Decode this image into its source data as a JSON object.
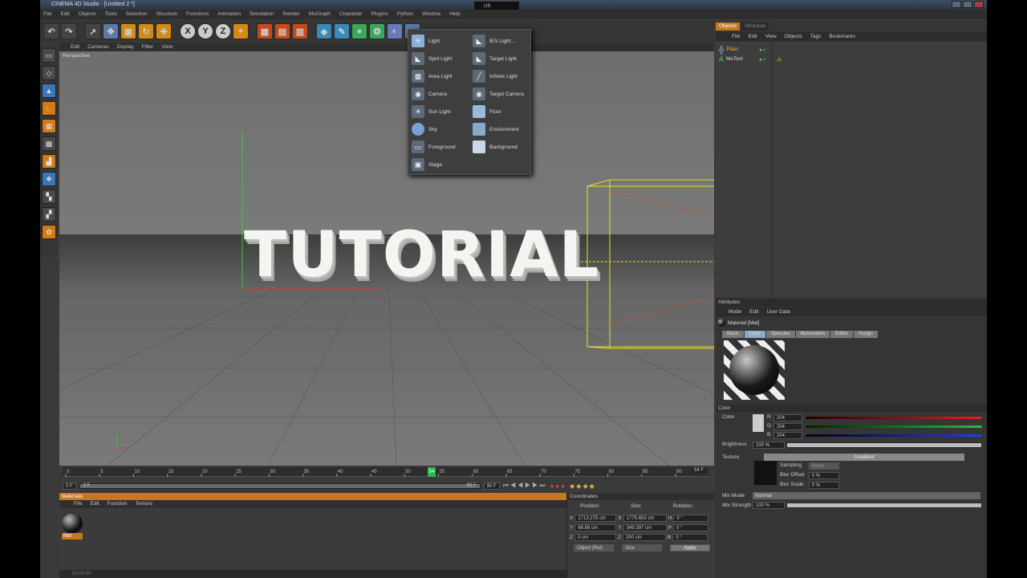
{
  "app": {
    "title": "CINEMA 4D Studio - [Untitled 2 *]",
    "lang": "US"
  },
  "menu": [
    "File",
    "Edit",
    "Objects",
    "Tools",
    "Selection",
    "Structure",
    "Functions",
    "Animation",
    "Simulation",
    "Render",
    "MoGraph",
    "Character",
    "Plugins",
    "Python",
    "Window",
    "Help"
  ],
  "toolbar": {
    "axis_labels": [
      "X",
      "Y",
      "Z"
    ]
  },
  "viewport": {
    "menu": [
      "Edit",
      "Cameras",
      "Display",
      "Filter",
      "View"
    ],
    "label": "Perspective",
    "text3d": "TUTORIAL"
  },
  "popup": {
    "left": [
      "Light",
      "Spot Light",
      "Area Light",
      "Camera",
      "Sun Light",
      "Sky",
      "Foreground",
      "Stage"
    ],
    "right": [
      "IES Light...",
      "Target Light",
      "Infinite Light",
      "Target Camera",
      "Floor",
      "Environment",
      "Background"
    ]
  },
  "timeline": {
    "ticks": [
      "0",
      "5",
      "10",
      "15",
      "20",
      "25",
      "30",
      "35",
      "40",
      "45",
      "50",
      "55",
      "60",
      "65",
      "70",
      "75",
      "80",
      "85",
      "90"
    ],
    "current_frame": 54,
    "current_label": "54",
    "end_label": "54 F",
    "start_field": "0 F",
    "min_field": "0 F",
    "max_field": "90 F",
    "end_field": "90 F"
  },
  "materials": {
    "header": "Materials",
    "menu": [
      "File",
      "Edit",
      "Function",
      "Texture"
    ],
    "item": "Mat"
  },
  "coordinates": {
    "header": "Coordinates",
    "cols": [
      "Position",
      "Size",
      "Rotation"
    ],
    "rows": [
      {
        "axis": "X",
        "pos": "1713.275 cm",
        "size_axis": "X",
        "size": "1775.653 cm",
        "rot_axis": "H",
        "rot": "0 °"
      },
      {
        "axis": "Y",
        "pos": "69.89 cm",
        "size_axis": "Y",
        "size": "349.397 cm",
        "rot_axis": "P",
        "rot": "0 °"
      },
      {
        "axis": "Z",
        "pos": "0 cm",
        "size_axis": "Z",
        "size": "200 cm",
        "rot_axis": "B",
        "rot": "0 °"
      }
    ],
    "mode": "Object (Rel)",
    "size_mode": "Size",
    "apply": "Apply"
  },
  "objects": {
    "tabs": [
      "Objects",
      "Structure"
    ],
    "menu": [
      "File",
      "Edit",
      "View",
      "Objects",
      "Tags",
      "Bookmarks"
    ],
    "items": [
      {
        "name": "Plain",
        "selected": true
      },
      {
        "name": "MoText",
        "selected": false
      }
    ]
  },
  "attributes": {
    "header": "Attributes",
    "menu": [
      "Mode",
      "Edit",
      "User Data"
    ],
    "material_title": "Material [Mat]",
    "channel_tabs": [
      "Basic",
      "Color",
      "Specular",
      "Illumination",
      "Editor",
      "Assign"
    ],
    "active_tab": "Color",
    "section": "Color",
    "color_label": "Color",
    "r": "204",
    "g": "204",
    "b": "204",
    "brightness_label": "Brightness",
    "brightness": "100 %",
    "brightness_fraction": 1.0,
    "texture_label": "Texture",
    "texture_value": "Gradient",
    "sampling_label": "Sampling",
    "sampling_value": "None",
    "blur_offset_label": "Blur Offset",
    "blur_offset": "0 %",
    "blur_scale_label": "Blur Scale",
    "blur_scale": "0 %",
    "mix_mode_label": "Mix Mode",
    "mix_mode": "Normal",
    "mix_strength_label": "Mix Strength",
    "mix_strength": "100 %"
  },
  "status": "00:00:03",
  "colors": {
    "accent": "#c27a1c",
    "selection": "#f2b730",
    "wire": "#e8e020"
  }
}
